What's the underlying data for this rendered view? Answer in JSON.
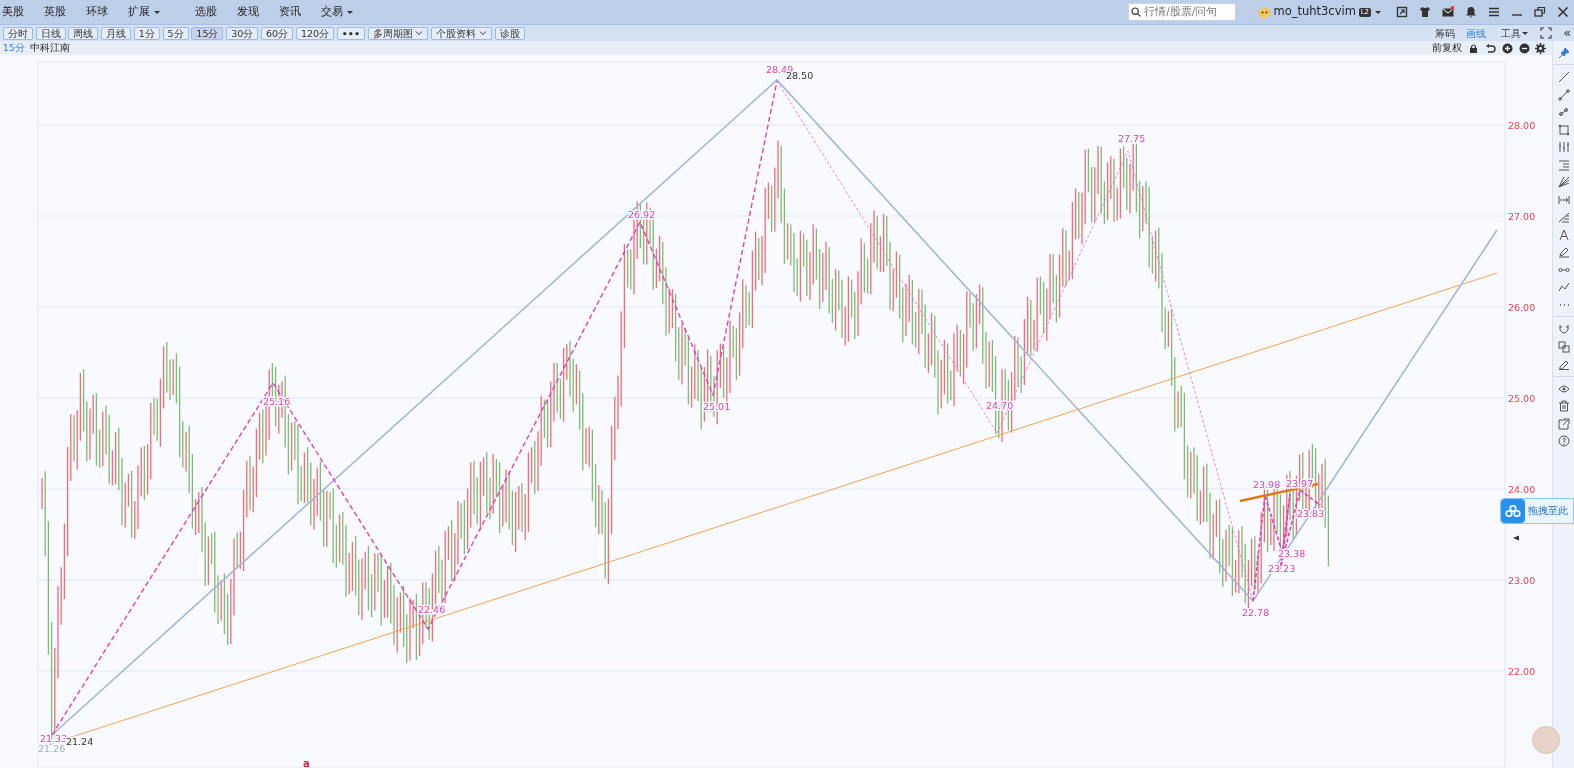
{
  "menu": [
    {
      "label": "美股",
      "dropdown": false
    },
    {
      "label": "英股",
      "dropdown": false
    },
    {
      "label": "环球",
      "dropdown": false
    },
    {
      "label": "扩展",
      "dropdown": true
    },
    {
      "label": "选股",
      "dropdown": false
    },
    {
      "label": "发现",
      "dropdown": false
    },
    {
      "label": "资讯",
      "dropdown": false
    },
    {
      "label": "交易",
      "dropdown": true
    }
  ],
  "search": {
    "placeholder": "行情/股票/问句"
  },
  "user": {
    "name": "mo_tuht3cvim",
    "badge": "L2",
    "mail_unread": true
  },
  "toolbar": [
    {
      "label": "分时",
      "kind": "period",
      "selected": false
    },
    {
      "label": "日线",
      "kind": "period",
      "selected": false
    },
    {
      "label": "周线",
      "kind": "period",
      "selected": false
    },
    {
      "label": "月线",
      "kind": "period",
      "selected": false
    },
    {
      "label": "1分",
      "kind": "period",
      "selected": false
    },
    {
      "label": "5分",
      "kind": "period",
      "selected": false
    },
    {
      "label": "15分",
      "kind": "period",
      "selected": true
    },
    {
      "label": "30分",
      "kind": "period",
      "selected": false
    },
    {
      "label": "60分",
      "kind": "period",
      "selected": false
    },
    {
      "label": "120分",
      "kind": "period",
      "selected": false
    },
    {
      "label": "•••",
      "kind": "more",
      "selected": false
    },
    {
      "label": "多周期图",
      "kind": "dropdown",
      "selected": false
    },
    {
      "label": "个股资料",
      "kind": "dropdown",
      "selected": false
    },
    {
      "label": "诊股",
      "kind": "button",
      "selected": false
    }
  ],
  "right_tabs": [
    {
      "label": "筹码",
      "selected": false,
      "dropdown": false
    },
    {
      "label": "画线",
      "selected": true,
      "dropdown": false
    },
    {
      "label": "工具",
      "selected": false,
      "dropdown": true
    }
  ],
  "collapse": "«",
  "info": {
    "period": "15分",
    "stock": "中科江南",
    "adjust": "前复权"
  },
  "chart": {
    "y_ticks": [
      "28.00",
      "27.00",
      "26.00",
      "25.00",
      "24.00",
      "23.00",
      "22.00"
    ],
    "labels": [
      {
        "text": "21.33",
        "color": "#e040b8"
      },
      {
        "text": "21.24",
        "color": "#333333"
      },
      {
        "text": "21.26",
        "color": "#9aaccc"
      },
      {
        "text": "25.16",
        "color": "#e040b8"
      },
      {
        "text": "22.46",
        "color": "#e040b8"
      },
      {
        "text": "26.92",
        "color": "#e040b8"
      },
      {
        "text": "25.01",
        "color": "#e040b8"
      },
      {
        "text": "28.49",
        "color": "#e040b8"
      },
      {
        "text": "28.50",
        "color": "#333333"
      },
      {
        "text": "24.70",
        "color": "#e040b8"
      },
      {
        "text": "27.75",
        "color": "#e040b8"
      },
      {
        "text": "23.98",
        "color": "#e040b8"
      },
      {
        "text": "23.97",
        "color": "#e040b8"
      },
      {
        "text": "23.83",
        "color": "#e040b8"
      },
      {
        "text": "23.38",
        "color": "#e040b8"
      },
      {
        "text": "23.23",
        "color": "#e040b8"
      },
      {
        "text": "22.78",
        "color": "#e040b8"
      }
    ],
    "marker": "a"
  },
  "drop_target": {
    "label": "拖拽至此"
  }
}
